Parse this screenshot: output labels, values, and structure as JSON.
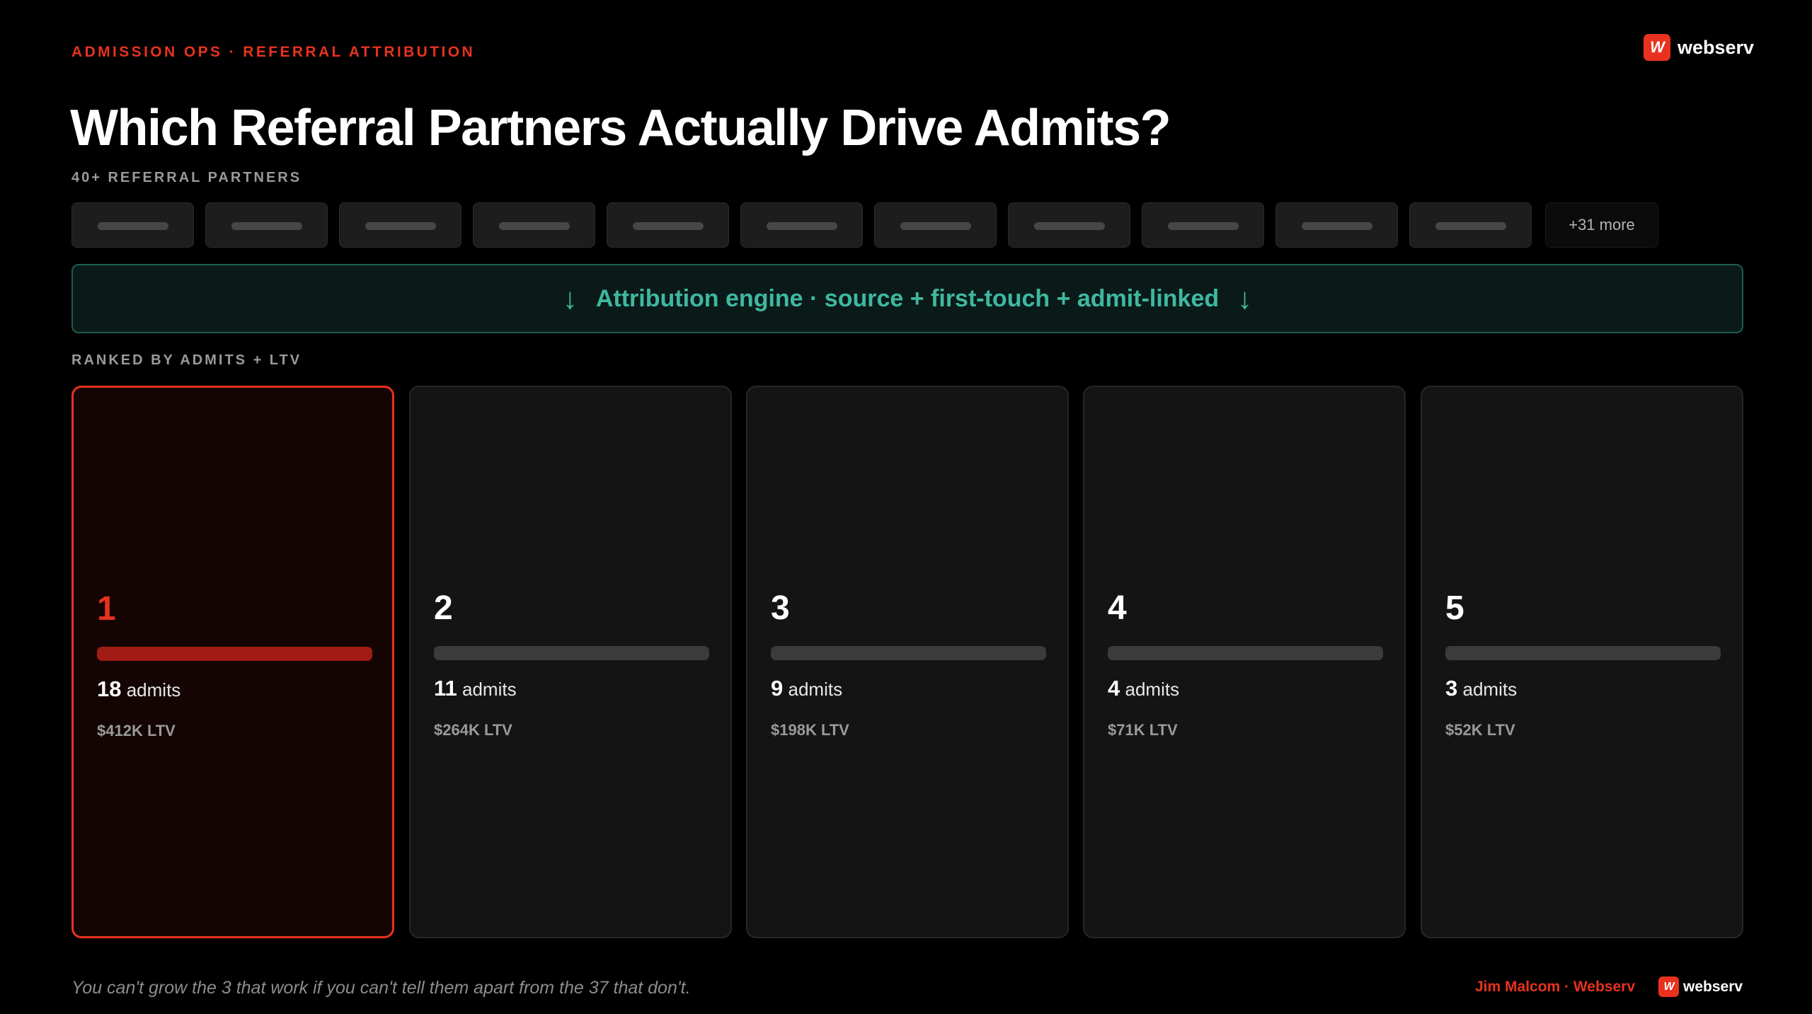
{
  "header": {
    "eyebrow": "ADMISSION OPS · REFERRAL ATTRIBUTION",
    "title": "Which Referral Partners Actually Drive Admits?",
    "brand_mark": "W",
    "brand_name": "webserv"
  },
  "partners": {
    "label": "40+ REFERRAL PARTNERS",
    "chip_count": 11,
    "more_label": "+31 more"
  },
  "engine": {
    "arrow_icon": "↓",
    "text": "Attribution engine · source + first-touch + admit-linked"
  },
  "ranking": {
    "label": "RANKED BY ADMITS + LTV",
    "admits_unit": "admits",
    "cards": [
      {
        "rank": "1",
        "admits": "18",
        "ltv": "$412K LTV",
        "highlight": true
      },
      {
        "rank": "2",
        "admits": "11",
        "ltv": "$264K LTV",
        "highlight": false
      },
      {
        "rank": "3",
        "admits": "9",
        "ltv": "$198K LTV",
        "highlight": false
      },
      {
        "rank": "4",
        "admits": "4",
        "ltv": "$71K LTV",
        "highlight": false
      },
      {
        "rank": "5",
        "admits": "3",
        "ltv": "$52K LTV",
        "highlight": false
      }
    ]
  },
  "footer": {
    "note": "You can't grow the 3 that work if you can't tell them apart from the 37 that don't.",
    "byline": "Jim Malcom · Webserv",
    "brand_mark": "W",
    "brand_name": "webserv"
  },
  "colors": {
    "accent": "#e8321f",
    "engine_teal": "#3fb8a0",
    "background": "#000000"
  }
}
